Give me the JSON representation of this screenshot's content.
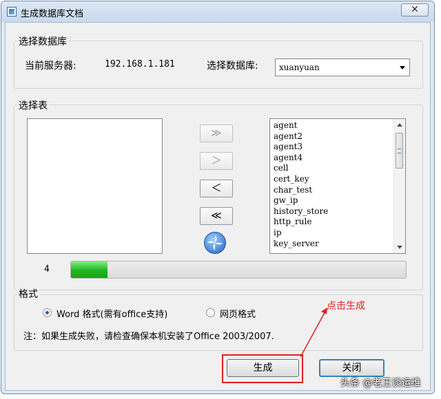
{
  "window": {
    "title": "生成数据库文档",
    "close_symbol": "✕"
  },
  "database_group": {
    "label": "选择数据库",
    "server_label": "当前服务器:",
    "server_value": "192.168.1.181",
    "db_label": "选择数据库:",
    "db_selected": "xuanyuan"
  },
  "table_group": {
    "label": "选择表",
    "buttons": {
      "add_all": "≫",
      "add": "＞",
      "remove": "＜",
      "remove_all": "≪"
    },
    "available_tables": [
      "agent",
      "agent2",
      "agent3",
      "agent4",
      "cell",
      "cert_key",
      "char_test",
      "gw_ip",
      "history_store",
      "http_rule",
      "ip",
      "key_server"
    ],
    "progress": {
      "count": "4",
      "fraction": 0.11,
      "fill_color": "#1fb51f"
    }
  },
  "format_group": {
    "label": "格式",
    "options": [
      {
        "label": "Word 格式(需有office支持)",
        "checked": true
      },
      {
        "label": "网页格式",
        "checked": false
      }
    ],
    "note": "注：如果生成失败，请检查确保本机安装了Office 2003/2007."
  },
  "footer": {
    "generate_label": "生成",
    "close_label": "关闭"
  },
  "annotation": {
    "text": "点击生成",
    "color": "#e02020"
  },
  "watermark": "头条 @老王谈运维"
}
